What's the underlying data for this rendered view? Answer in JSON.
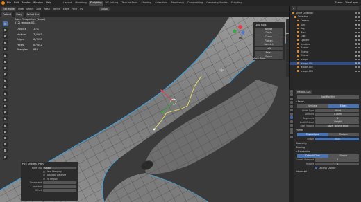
{
  "menu": {
    "items": [
      "File",
      "Edit",
      "Render",
      "Window",
      "Help"
    ],
    "workspaces": [
      "Layout",
      "Modeling",
      "Sculpting",
      "UV Editing",
      "Texture Paint",
      "Shading",
      "Animation",
      "Rendering",
      "Compositing",
      "Geometry Nodes",
      "Scripting"
    ],
    "active_workspace": "Sculpting",
    "scene": "Scene",
    "view_layer": "ViewLayer"
  },
  "viewport_header": {
    "mode": "Edit Mode",
    "menus": [
      "View",
      "Select",
      "Add",
      "Mesh",
      "Vertex",
      "Edge",
      "Face",
      "UV"
    ],
    "orientation": "Global",
    "pivot": "Default",
    "drag": "Drag",
    "snap": "Select Box"
  },
  "overlay": {
    "view_name": "User Perspective (Local)",
    "object_name": "(12) reloops.001",
    "stats": [
      {
        "label": "Objects",
        "value": "1 / 1"
      },
      {
        "label": "Vertices",
        "value": "7 / 492"
      },
      {
        "label": "Edges",
        "value": "6 / 933"
      },
      {
        "label": "Faces",
        "value": "0 / 442"
      },
      {
        "label": "Triangles",
        "value": "884"
      }
    ]
  },
  "looptools": {
    "title": "LoopTools",
    "buttons": [
      "Bridge",
      "Circle",
      "Curve",
      "Flatten",
      "Gstretch",
      "Loft",
      "Relax",
      "Space"
    ]
  },
  "mesh_tools": {
    "title": "Mesh Tools"
  },
  "operator_panel": {
    "title": "Pick Shortest Path",
    "rows": [
      {
        "label": "Edge Tag",
        "value": "Select",
        "type": "select"
      },
      {
        "label": "",
        "value": "Face Stepping",
        "type": "check"
      },
      {
        "label": "",
        "value": "Topology Distance",
        "type": "check"
      },
      {
        "label": "",
        "value": "Fill Region",
        "type": "check"
      },
      {
        "label": "Deselected",
        "value": "",
        "type": "num"
      },
      {
        "label": "Selected",
        "value": "",
        "type": "num"
      },
      {
        "label": "Offset",
        "value": "",
        "type": "num"
      }
    ]
  },
  "outliner": {
    "title": "Scene Collection",
    "rows": [
      {
        "name": "Scene Collection",
        "selected": false
      },
      {
        "name": "Collection",
        "selected": false
      },
      {
        "name": "Camera",
        "selected": false
      },
      {
        "name": "Light",
        "selected": false
      },
      {
        "name": "Bag",
        "selected": false
      },
      {
        "name": "Mesh",
        "selected": false
      },
      {
        "name": "Cube",
        "selected": false
      },
      {
        "name": "Cylinder",
        "selected": false
      },
      {
        "name": "Armature",
        "selected": false
      },
      {
        "name": "Ethanol",
        "selected": false
      },
      {
        "name": "Ethanol",
        "selected": false
      },
      {
        "name": "Ethanol",
        "selected": false
      },
      {
        "name": "reloops",
        "selected": false
      },
      {
        "name": "reloops.001",
        "selected": true
      },
      {
        "name": "reloops.002",
        "selected": false
      },
      {
        "name": "reloops.003",
        "selected": false
      }
    ]
  },
  "properties": {
    "object_name": "reloops.001",
    "modifier_name": "Bevel",
    "add_modifier": "Add Modifier",
    "affect": [
      "Vertices",
      "Edges"
    ],
    "affect_active": "Edges",
    "rows": [
      {
        "label": "Width Type",
        "value": "Offset"
      },
      {
        "label": "Amount",
        "value": "0.08 m"
      },
      {
        "label": "Segments",
        "value": "1"
      },
      {
        "label": "Limit Method",
        "value": "Weight"
      },
      {
        "label": "Edge Weight",
        "value": "bevel_weight_edge"
      }
    ],
    "sections": {
      "profile": "Profile",
      "geometry": "Geometry",
      "shading": "Shading"
    },
    "profile_types": [
      "Superellipse",
      "Custom"
    ],
    "profile_active": "Superellipse",
    "shape": {
      "label": "Shape",
      "value": "0.50"
    },
    "subdiv_modifier": "Subdivision",
    "subdiv_types": [
      "Catmull-Clark",
      "Simple"
    ],
    "subdiv_active": "Catmull-Clark",
    "subdiv_rows": [
      {
        "label": "Levels Viewport",
        "value": "1"
      },
      {
        "label": "Render",
        "value": "2"
      }
    ],
    "optimal_display": "Optimal Display",
    "advanced": "Advanced"
  }
}
